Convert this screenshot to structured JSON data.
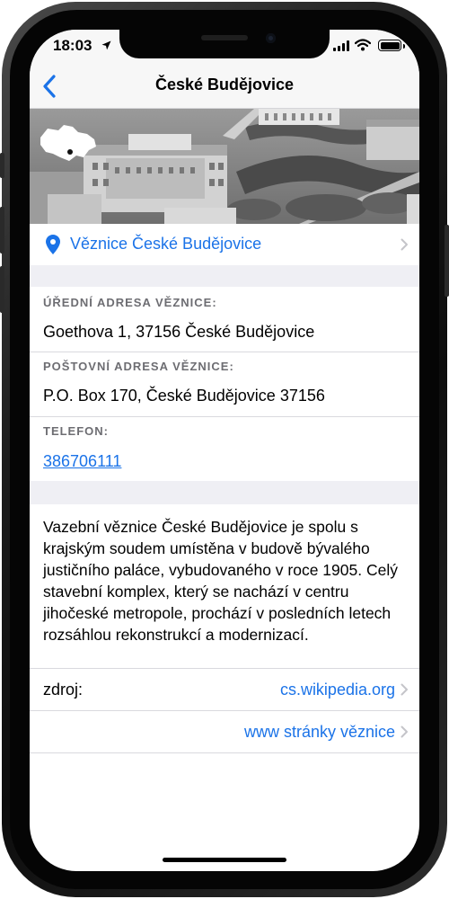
{
  "status_bar": {
    "time": "18:03",
    "location_icon": "location-arrow-icon",
    "signal_icon": "cellular-signal-icon",
    "wifi_icon": "wifi-icon",
    "battery_icon": "battery-icon",
    "battery_level": 1.0
  },
  "nav": {
    "back_icon": "chevron-left-icon",
    "title": "České Budějovice"
  },
  "hero": {
    "image": "aerial-city-photo",
    "overlay_icon": "czech-map-icon"
  },
  "prison": {
    "pin_icon": "map-pin-icon",
    "name": "Věznice České Budějovice"
  },
  "addresses": {
    "official_label": "ÚŘEDNÍ ADRESA VĚZNICE:",
    "official_value": "Goethova 1, 37156 České Budějovice",
    "postal_label": "POŠTOVNÍ ADRESA VĚZNICE:",
    "postal_value": "P.O. Box 170, České Budějovice 37156",
    "phone_label": "TELEFON:",
    "phone_value": "386706111"
  },
  "description": "Vazební věznice České Budějovice je spolu s krajským soudem umístěna v budově bývalého justičního paláce, vybudovaného v roce 1905. Celý stavební komplex, který se nachází v centru jihočeské metropole, prochází v posledních letech rozsáhlou rekonstrukcí a modernizací.",
  "links": {
    "source_label": "zdroj:",
    "source_value": "cs.wikipedia.org",
    "website_value": "www stránky věznice"
  },
  "colors": {
    "accent": "#1b73e8",
    "section_background": "#efeff4",
    "caption_text": "#6d6d72"
  }
}
